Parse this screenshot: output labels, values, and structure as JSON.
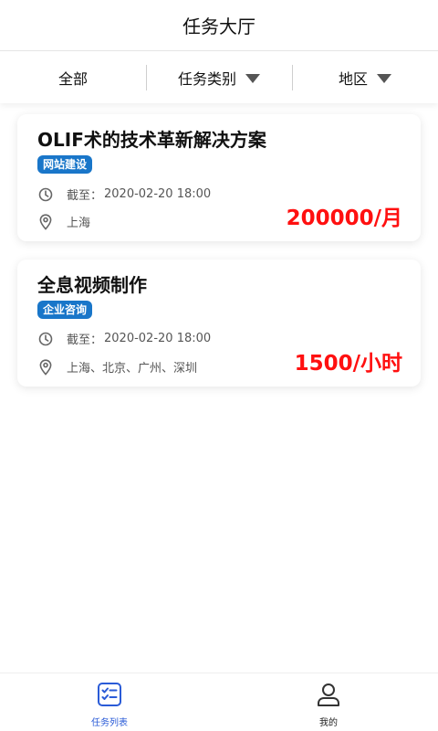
{
  "header": {
    "title": "任务大厅"
  },
  "filters": [
    {
      "label": "全部",
      "has_dropdown": false
    },
    {
      "label": "任务类别",
      "has_dropdown": true
    },
    {
      "label": "地区",
      "has_dropdown": true
    }
  ],
  "tasks": [
    {
      "title": "OLIF术的技术革新解决方案",
      "tag": "网站建设",
      "deadline_prefix": "截至：",
      "deadline": "2020-02-20 18:00",
      "location": "上海",
      "price": "200000/月"
    },
    {
      "title": "全息视频制作",
      "tag": "企业咨询",
      "deadline_prefix": "截至：",
      "deadline": "2020-02-20 18:00",
      "location": "上海、北京、广州、深圳",
      "price": "1500/小时"
    }
  ],
  "bottom_nav": [
    {
      "label": "任务列表",
      "icon": "task-list-icon",
      "active": true
    },
    {
      "label": "我的",
      "icon": "user-icon",
      "active": false
    }
  ],
  "colors": {
    "accent": "#1976c9",
    "price": "#ff1010",
    "nav_active": "#2a5bd7"
  }
}
